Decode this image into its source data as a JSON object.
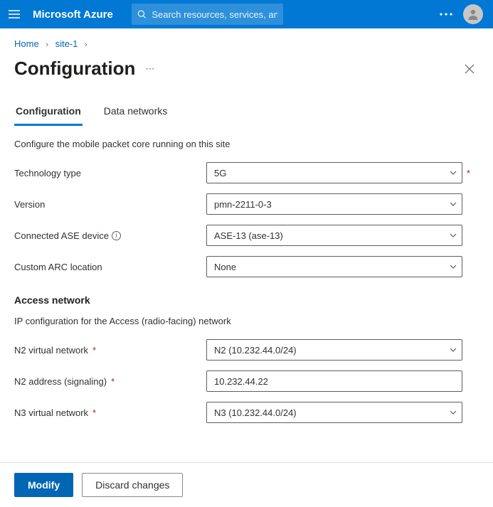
{
  "header": {
    "brand": "Microsoft Azure",
    "search_placeholder": "Search resources, services, and docs (G+/)"
  },
  "breadcrumb": {
    "items": [
      "Home",
      "site-1"
    ]
  },
  "page": {
    "title": "Configuration"
  },
  "tabs": [
    {
      "label": "Configuration",
      "active": true
    },
    {
      "label": "Data networks",
      "active": false
    }
  ],
  "intro": "Configure the mobile packet core running on this site",
  "fields": {
    "technology_type": {
      "label": "Technology type",
      "value": "5G",
      "required": true
    },
    "version": {
      "label": "Version",
      "value": "pmn-2211-0-3",
      "required": false
    },
    "connected_ase": {
      "label": "Connected ASE device",
      "value": "ASE-13 (ase-13)",
      "info": true
    },
    "custom_arc": {
      "label": "Custom ARC location",
      "value": "None"
    }
  },
  "access_network": {
    "heading": "Access network",
    "subtext": "IP configuration for the Access (radio-facing) network",
    "n2_vnet": {
      "label": "N2 virtual network",
      "value": "N2 (10.232.44.0/24)",
      "required": true
    },
    "n2_addr": {
      "label": "N2 address (signaling)",
      "value": "10.232.44.22",
      "required": true
    },
    "n3_vnet": {
      "label": "N3 virtual network",
      "value": "N3 (10.232.44.0/24)",
      "required": true
    }
  },
  "footer": {
    "primary": "Modify",
    "secondary": "Discard changes"
  }
}
